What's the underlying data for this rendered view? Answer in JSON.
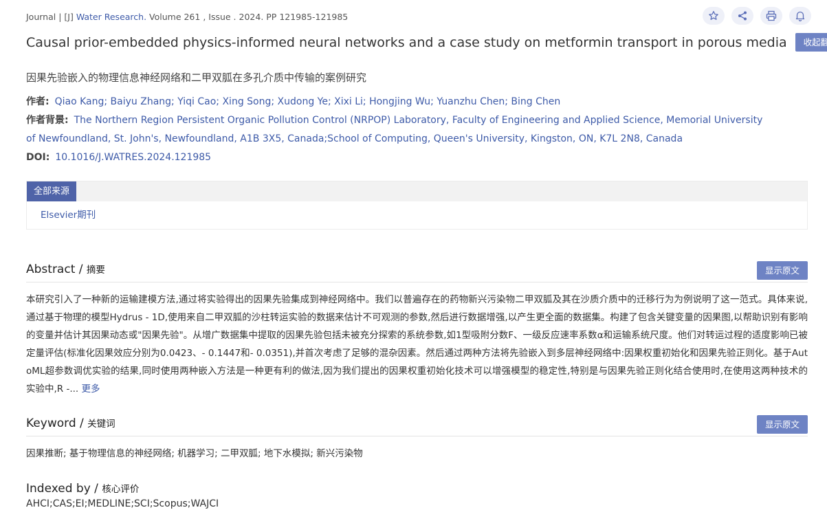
{
  "journal_line": {
    "prefix": "Journal | [J] ",
    "journal": "Water Research.",
    "details": " Volume 261 , Issue . 2024. PP 121985-121985"
  },
  "actions": [
    {
      "name": "star-icon",
      "label": "收藏"
    },
    {
      "name": "share-icon",
      "label": "分享"
    },
    {
      "name": "print-icon",
      "label": "打印"
    },
    {
      "name": "bell-icon",
      "label": "订阅"
    }
  ],
  "title_en": "Causal prior-embedded physics-informed neural networks and a case study on metformin transport in porous media",
  "collapse_translation_label": "收起翻译",
  "title_cn": "因果先验嵌入的物理信息神经网络和二甲双胍在多孔介质中传输的案例研究",
  "authors": {
    "label": "作者:",
    "value": "Qiao Kang; Baiyu Zhang; Yiqi Cao; Xing Song; Xudong Ye; Xixi Li; Hongjing Wu; Yuanzhu Chen; Bing Chen"
  },
  "affiliation": {
    "label": "作者背景:",
    "value": "The Northern Region Persistent Organic Pollution Control (NRPOP) Laboratory, Faculty of Engineering and Applied Science, Memorial University of Newfoundland, St. John's, Newfoundland, A1B 3X5, Canada;School of Computing, Queen's University, Kingston, ON, K7L 2N8, Canada"
  },
  "doi": {
    "label": "DOI:",
    "value": "10.1016/J.WATRES.2024.121985"
  },
  "sources": {
    "tab_label": "全部来源",
    "items": [
      "Elsevier期刊"
    ]
  },
  "abstract": {
    "heading": "Abstract / ",
    "heading_cn": "摘要",
    "show_original_label": "显示原文",
    "text": "本研究引入了一种新的运输建模方法,通过将实验得出的因果先验集成到神经网络中。我们以普遍存在的药物新兴污染物二甲双胍及其在沙质介质中的迁移行为为例说明了这一范式。具体来说,通过基于物理的模型Hydrus - 1D,使用来自二甲双胍的沙柱转运实验的数据来估计不可观测的参数,然后进行数据增强,以产生更全面的数据集。构建了包含关键变量的因果图,以帮助识别有影响的变量并估计其因果动态或\"因果先验\"。从增广数据集中提取的因果先验包括未被充分探索的系统参数,如1型吸附分数F、一级反应速率系数α和运输系统尺度。他们对转运过程的适度影响已被定量评估(标准化因果效应分别为0.0423、- 0.1447和- 0.0351),并首次考虑了足够的混杂因素。然后通过两种方法将先验嵌入到多层神经网络中:因果权重初始化和因果先验正则化。基于AutoML超参数调优实验的结果,同时使用两种嵌入方法是一种更有利的做法,因为我们提出的因果权重初始化技术可以增强模型的稳定性,特别是与因果先验正则化结合使用时,在使用这两种技术的实验中,R -... ",
    "more_label": "更多"
  },
  "keyword": {
    "heading": "Keyword / ",
    "heading_cn": "关键词",
    "show_original_label": "显示原文",
    "text": "因果推断; 基于物理信息的神经网络; 机器学习; 二甲双胍; 地下水模拟; 新兴污染物"
  },
  "indexed": {
    "heading": "Indexed by / ",
    "heading_cn": "核心评价",
    "text": "AHCI;CAS;EI;MEDLINE;SCI;Scopus;WAJCI"
  }
}
